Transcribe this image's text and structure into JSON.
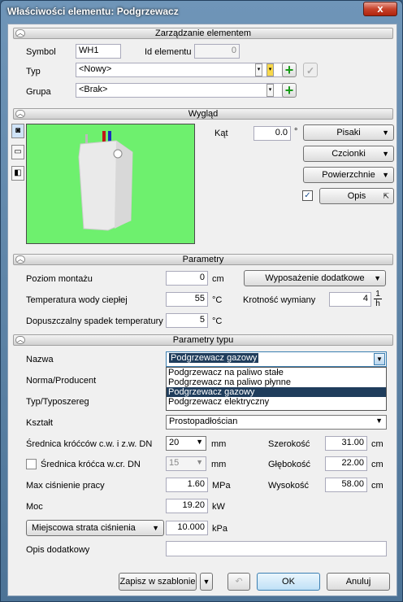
{
  "window": {
    "title": "Właściwości elementu: Podgrzewacz",
    "close_label": "x"
  },
  "sections": {
    "management": "Zarządzanie elementem",
    "appearance": "Wygląd",
    "params": "Parametry",
    "type_params": "Parametry typu"
  },
  "management": {
    "symbol_label": "Symbol",
    "symbol_value": "WH1",
    "id_label": "Id elementu",
    "id_value": "0",
    "type_label": "Typ",
    "type_value": "<Nowy>",
    "group_label": "Grupa",
    "group_value": "<Brak>"
  },
  "appearance": {
    "angle_label": "Kąt",
    "angle_value": "0.0",
    "angle_unit": "°",
    "pens_label": "Pisaki",
    "fonts_label": "Czcionki",
    "surfaces_label": "Powierzchnie",
    "desc_label": "Opis",
    "desc_checked": true
  },
  "params": {
    "height_label": "Poziom montażu",
    "height_value": "0",
    "height_unit": "cm",
    "equip_label": "Wyposażenie dodatkowe",
    "temp_label": "Temperatura wody ciepłej",
    "temp_value": "55",
    "temp_unit": "°C",
    "mult_label": "Krotność wymiany",
    "mult_value": "4",
    "mult_unit_num": "1",
    "mult_unit_den": "h",
    "drop_label": "Dopuszczalny spadek temperatury",
    "drop_value": "5",
    "drop_unit": "°C"
  },
  "type_params": {
    "name_label": "Nazwa",
    "name_value": "Podgrzewacz gazowy",
    "options": [
      "Podgrzewacz na paliwo stałe",
      "Podgrzewacz na paliwo płynne",
      "Podgrzewacz gazowy",
      "Podgrzewacz elektryczny"
    ],
    "selected_index": 2,
    "norm_label": "Norma/Producent",
    "series_label": "Typ/Typoszereg",
    "shape_label": "Kształt",
    "shape_value": "Prostopadłościan",
    "dn_label": "Średnica króćców c.w. i z.w. DN",
    "dn_value": "20",
    "dn_unit": "mm",
    "dncr_label": "Średnica króćca w.cr. DN",
    "dncr_value": "15",
    "dncr_unit": "mm",
    "width_label": "Szerokość",
    "width_value": "31.00",
    "width_unit": "cm",
    "depth_label": "Głębokość",
    "depth_value": "22.00",
    "depth_unit": "cm",
    "pressure_label": "Max ciśnienie pracy",
    "pressure_value": "1.60",
    "pressure_unit": "MPa",
    "tall_label": "Wysokość",
    "tall_value": "58.00",
    "tall_unit": "cm",
    "power_label": "Moc",
    "power_value": "19.20",
    "power_unit": "kW",
    "loss_label": "Miejscowa strata ciśnienia",
    "loss_value": "10.000",
    "loss_unit": "kPa",
    "extra_label": "Opis dodatkowy",
    "extra_value": ""
  },
  "footer": {
    "save_template": "Zapisz w szablonie",
    "ok": "OK",
    "cancel": "Anuluj"
  },
  "colors": {
    "preview_bg": "#6ef06e",
    "list_selected": "#1f3d5c"
  }
}
